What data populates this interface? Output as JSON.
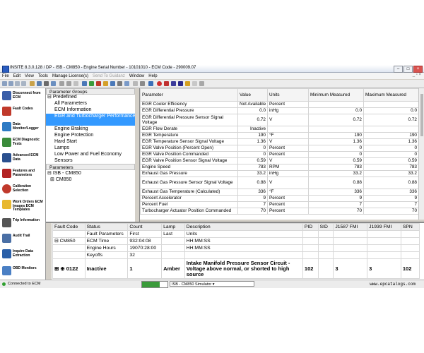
{
  "window": {
    "title": "INSITE 8.3.0.128 / DP - ISB - CM850 - Engine Serial Number - 10101010 - ECM Code - 290009.07"
  },
  "menu": {
    "items": [
      "File",
      "Edit",
      "View",
      "Tools",
      "Manage License(s)",
      "Send To Guidanz",
      "Window",
      "Help"
    ]
  },
  "sidebar": {
    "items": [
      {
        "label": "Disconnect from ECM",
        "icon": "disconnect-icon",
        "color": "#3a5ea8"
      },
      {
        "label": "Fault Codes",
        "icon": "fault-codes-icon",
        "color": "#c0392b"
      },
      {
        "label": "Data Monitor/Logger",
        "icon": "data-monitor-icon",
        "color": "#2e7bc4"
      },
      {
        "label": "ECM Diagnostic Tests",
        "icon": "diagnostic-tests-icon",
        "color": "#3a8b3a"
      },
      {
        "label": "Advanced ECM Data",
        "icon": "advanced-ecm-icon",
        "color": "#2a4f8e"
      },
      {
        "label": "Features and Parameters",
        "icon": "features-icon",
        "color": "#b22222"
      },
      {
        "label": "Calibration Selection",
        "icon": "calibration-icon",
        "color": "#c0392b"
      },
      {
        "label": "Work Orders ECM Images ECM Templates",
        "icon": "work-orders-icon",
        "color": "#e8b830"
      },
      {
        "label": "Trip Information",
        "icon": "trip-info-icon",
        "color": "#555555"
      },
      {
        "label": "Audit Trail",
        "icon": "audit-trail-icon",
        "color": "#4a6fa5"
      },
      {
        "label": "Inquire Data Extraction",
        "icon": "inquire-icon",
        "color": "#2a5fa8"
      },
      {
        "label": "OBD Monitors",
        "icon": "obd-monitors-icon",
        "color": "#4a7fc4"
      }
    ]
  },
  "groups": {
    "header": "Parameter Groups",
    "predefined_label": "Predefined",
    "items": [
      "All Parameters",
      "ECM Information",
      "EGR and Turbocharger Performance",
      "Engine Braking",
      "Engine Protection",
      "Hard Start",
      "Lamps",
      "Low Power and Fuel Economy",
      "Sensors"
    ],
    "selected_index": 2
  },
  "parameters_tree": {
    "header": "Parameters",
    "root": "ISB - CM850",
    "child": "CM850"
  },
  "param_table": {
    "headers": [
      "Parameter",
      "Value",
      "Units",
      "Minimum Measured",
      "Maximum Measured"
    ],
    "rows": [
      {
        "name": "EGR Cooler Efficiency",
        "value": "Not Available",
        "units": "Percent",
        "min": "",
        "max": ""
      },
      {
        "name": "EGR Differential Pressure",
        "value": "0.0",
        "units": "inHg",
        "min": "0.0",
        "max": "0.0"
      },
      {
        "name": "EGR Differential Pressure Sensor Signal Voltage",
        "value": "0.72",
        "units": "V",
        "min": "0.72",
        "max": "0.72"
      },
      {
        "name": "EGR Flow Derate",
        "value": "Inactive",
        "units": "",
        "min": "",
        "max": ""
      },
      {
        "name": "EGR Temperature",
        "value": "190",
        "units": "°F",
        "min": "190",
        "max": "190"
      },
      {
        "name": "EGR Temperature Sensor Signal Voltage",
        "value": "1.36",
        "units": "V",
        "min": "1.36",
        "max": "1.36"
      },
      {
        "name": "EGR Valve Position (Percent Open)",
        "value": "0",
        "units": "Percent",
        "min": "0",
        "max": "0"
      },
      {
        "name": "EGR Valve Position Commanded",
        "value": "0",
        "units": "Percent",
        "min": "0",
        "max": "0"
      },
      {
        "name": "EGR Valve Position Sensor Signal Voltage",
        "value": "0.59",
        "units": "V",
        "min": "0.59",
        "max": "0.59"
      },
      {
        "name": "Engine Speed",
        "value": "783",
        "units": "RPM",
        "min": "783",
        "max": "783"
      },
      {
        "name": "Exhaust Gas Pressure",
        "value": "33.2",
        "units": "inHg",
        "min": "33.2",
        "max": "33.2"
      },
      {
        "name": "Exhaust Gas Pressure Sensor Signal Voltage",
        "value": "0.88",
        "units": "V",
        "min": "0.88",
        "max": "0.88"
      },
      {
        "name": "Exhaust Gas Temperature (Calculated)",
        "value": "336",
        "units": "°F",
        "min": "336",
        "max": "336"
      },
      {
        "name": "Percent Accelerator",
        "value": "9",
        "units": "Percent",
        "min": "9",
        "max": "9"
      },
      {
        "name": "Percent Fuel",
        "value": "7",
        "units": "Percent",
        "min": "7",
        "max": "7"
      },
      {
        "name": "Turbocharger Actuator Position Commanded",
        "value": "70",
        "units": "Percent",
        "min": "70",
        "max": "70"
      }
    ]
  },
  "fault_table": {
    "side_label": "Fault Codes",
    "headers": [
      "Fault Code",
      "Status",
      "Count",
      "Lamp",
      "Description",
      "PID",
      "SID",
      "J1587 FMI",
      "J1939 FMI",
      "SPN"
    ],
    "sub_header": {
      "status": "Fault Parameters",
      "count": "First",
      "lamp": "Last",
      "desc": "Units"
    },
    "param_rows": [
      {
        "code": "CM850",
        "status": "ECM Time",
        "count": "932:04:08",
        "desc": "HH:MM:SS"
      },
      {
        "code": "",
        "status": "Engine Hours",
        "count": "19070:28:00",
        "desc": "HH:MM:SS"
      },
      {
        "code": "",
        "status": "Keyoffs",
        "count": "32",
        "desc": ""
      }
    ],
    "fault": {
      "code": "0122",
      "status": "Inactive",
      "count": "1",
      "lamp": "Amber",
      "desc": "Intake Manifold Pressure Sensor Circuit - Voltage above normal, or shorted to high source",
      "pid": "102",
      "sid": "",
      "j1587": "3",
      "j1939": "3",
      "spn": "102"
    }
  },
  "status": {
    "connection": "Connected to ECM",
    "progress": 0.7,
    "simulator": "ISB - CM850 Simulator",
    "website": "www.epcatalogs.com"
  }
}
